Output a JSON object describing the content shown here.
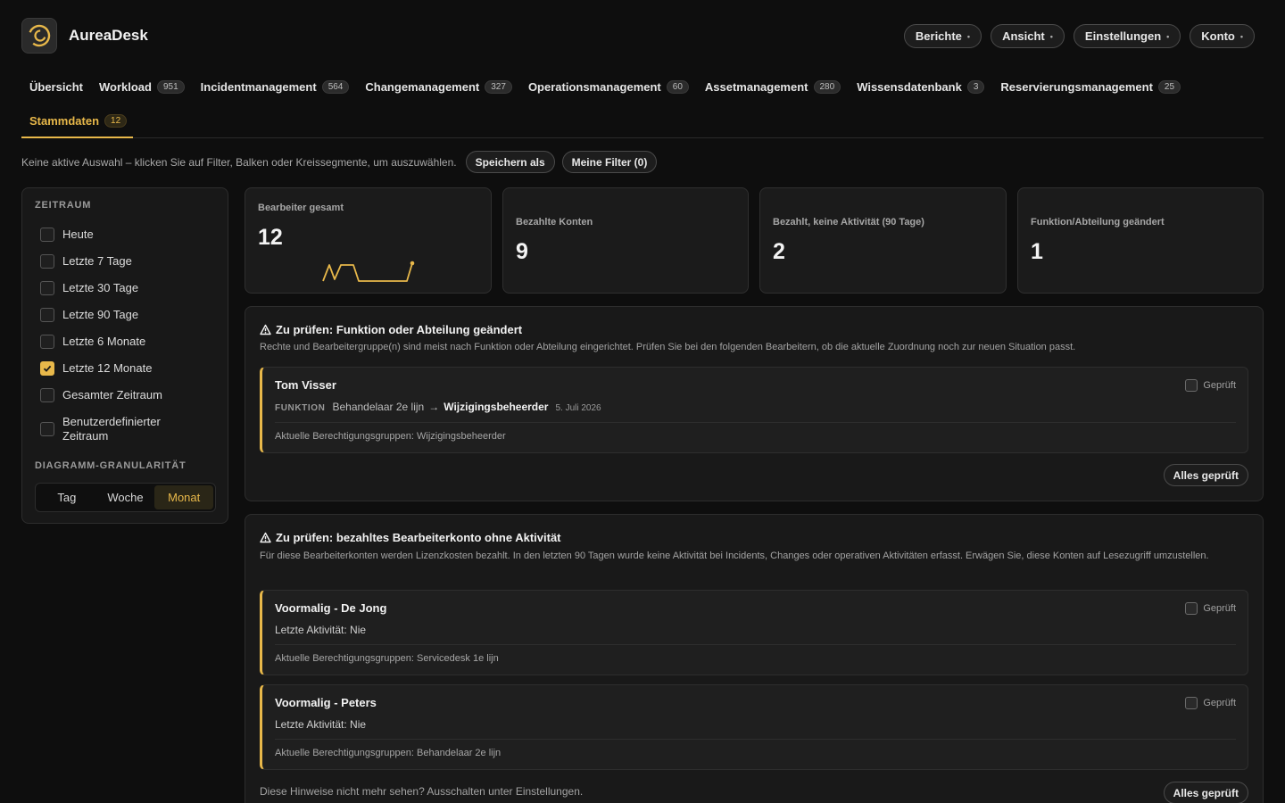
{
  "app": {
    "name": "AureaDesk",
    "accent": "#e8b84a"
  },
  "top_menu": [
    {
      "label": "Berichte"
    },
    {
      "label": "Ansicht"
    },
    {
      "label": "Einstellungen"
    },
    {
      "label": "Konto"
    }
  ],
  "tabs": [
    {
      "label": "Übersicht",
      "count": ""
    },
    {
      "label": "Workload",
      "count": "951"
    },
    {
      "label": "Incidentmanagement",
      "count": "564"
    },
    {
      "label": "Changemanagement",
      "count": "327"
    },
    {
      "label": "Operationsmanagement",
      "count": "60"
    },
    {
      "label": "Assetmanagement",
      "count": "280"
    },
    {
      "label": "Wissensdatenbank",
      "count": "3"
    },
    {
      "label": "Reservierungsmanagement",
      "count": "25"
    },
    {
      "label": "Stammdaten",
      "count": "12",
      "active": true
    }
  ],
  "selection": {
    "text": "Keine aktive Auswahl – klicken Sie auf Filter, Balken oder Kreissegmente, um auszuwählen.",
    "save_as": "Speichern als",
    "my_filters": "Meine Filter (0)"
  },
  "sidebar": {
    "period_heading": "ZEITRAUM",
    "options": [
      {
        "label": "Heute",
        "checked": false
      },
      {
        "label": "Letzte 7 Tage",
        "checked": false
      },
      {
        "label": "Letzte 30 Tage",
        "checked": false
      },
      {
        "label": "Letzte 90 Tage",
        "checked": false
      },
      {
        "label": "Letzte 6 Monate",
        "checked": false
      },
      {
        "label": "Letzte 12 Monate",
        "checked": true
      },
      {
        "label": "Gesamter Zeitraum",
        "checked": false
      },
      {
        "label": "Benutzerdefinierter Zeitraum",
        "checked": false
      }
    ],
    "granularity_heading": "DIAGRAMM-GRANULARITÄT",
    "granularity": [
      {
        "label": "Tag",
        "active": false
      },
      {
        "label": "Woche",
        "active": false
      },
      {
        "label": "Monat",
        "active": true
      }
    ]
  },
  "kpis": [
    {
      "label": "Bearbeiter gesamt",
      "value": "12"
    },
    {
      "label": "Bezahlte Konten",
      "value": "9"
    },
    {
      "label": "Bezahlt, keine Aktivität (90 Tage)",
      "value": "2"
    },
    {
      "label": "Funktion/Abteilung geändert",
      "value": "1"
    }
  ],
  "panel_function": {
    "title": "Zu prüfen: Funktion oder Abteilung geändert",
    "description": "Rechte und Bearbeitergruppe(n) sind meist nach Funktion oder Abteilung eingerichtet. Prüfen Sie bei den folgenden Bearbeitern, ob die aktuelle Zuordnung noch zur neuen Situation passt.",
    "items": [
      {
        "name": "Tom Visser",
        "checked_label": "Geprüft",
        "field_label": "FUNKTION",
        "old_value": "Behandelaar 2e lijn",
        "arrow": "→",
        "new_value": "Wijzigingsbeheerder",
        "date": "5. Juli 2026",
        "groups": "Aktuelle Berechtigungsgruppen: Wijzigingsbeheerder"
      }
    ],
    "all_checked": "Alles geprüft"
  },
  "panel_inactive": {
    "title": "Zu prüfen: bezahltes Bearbeiterkonto ohne Aktivität",
    "description": "Für diese Bearbeiterkonten werden Lizenzkosten bezahlt. In den letzten 90 Tagen wurde keine Aktivität bei Incidents, Changes oder operativen Aktivitäten erfasst. Erwägen Sie, diese Konten auf Lesezugriff umzustellen.",
    "items": [
      {
        "name": "Voormalig - De Jong",
        "checked_label": "Geprüft",
        "activity": "Letzte Aktivität: Nie",
        "groups": "Aktuelle Berechtigungsgruppen: Servicedesk 1e lijn"
      },
      {
        "name": "Voormalig - Peters",
        "checked_label": "Geprüft",
        "activity": "Letzte Aktivität: Nie",
        "groups": "Aktuelle Berechtigungsgruppen: Behandelaar 2e lijn"
      }
    ],
    "footer_note": "Diese Hinweise nicht mehr sehen? Ausschalten unter Einstellungen.",
    "all_checked": "Alles geprüft"
  }
}
